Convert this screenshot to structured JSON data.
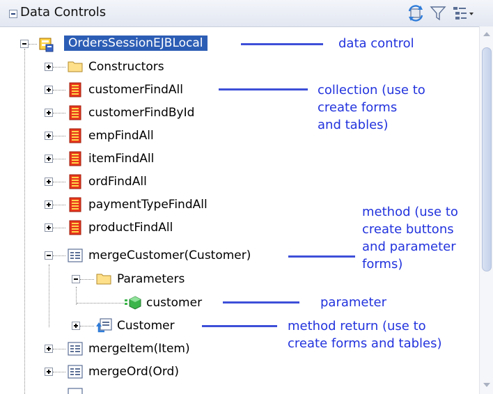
{
  "header": {
    "title": "Data Controls",
    "icons": [
      "refresh-icon",
      "filter-icon",
      "view-options-icon"
    ]
  },
  "tree": {
    "root": "OrdersSessionEJBLocal",
    "items": [
      "Constructors",
      "customerFindAll",
      "customerFindById",
      "empFindAll",
      "itemFindAll",
      "ordFindAll",
      "paymentTypeFindAll",
      "productFindAll",
      "mergeCustomer(Customer)",
      "Parameters",
      "customer",
      "Customer",
      "mergeItem(Item)",
      "mergeOrd(Ord)"
    ]
  },
  "annotations": {
    "data_control": "data control",
    "collection": [
      "collection (use to",
      "create forms",
      "and tables)"
    ],
    "method": [
      "method (use to",
      "create buttons",
      "and parameter",
      "forms)"
    ],
    "parameter": "parameter",
    "method_return": [
      "method return (use to",
      "create forms and tables)"
    ]
  },
  "colors": {
    "annotation": "#2233dd",
    "selection": "#2c5db5",
    "collection_icon": "#e8371c",
    "parameter_icon": "#3bb54a"
  }
}
